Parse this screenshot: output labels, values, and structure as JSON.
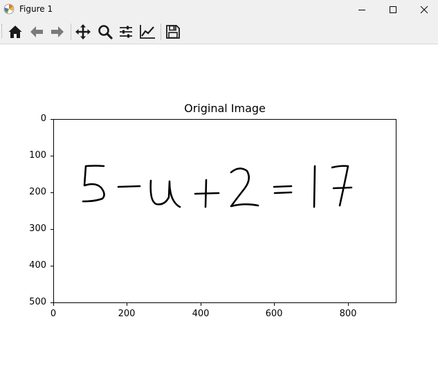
{
  "window": {
    "title": "Figure 1",
    "icon": "matplotlib-icon"
  },
  "window_controls": {
    "minimize_icon": "minimize-icon",
    "maximize_icon": "maximize-icon",
    "close_icon": "close-icon"
  },
  "toolbar": {
    "buttons": [
      {
        "name": "home",
        "icon": "home-icon"
      },
      {
        "name": "back",
        "icon": "arrow-left-icon"
      },
      {
        "name": "forward",
        "icon": "arrow-right-icon"
      },
      {
        "name": "pan",
        "icon": "move-icon"
      },
      {
        "name": "zoom",
        "icon": "zoom-icon"
      },
      {
        "name": "configure-subplots",
        "icon": "sliders-icon"
      },
      {
        "name": "edit-axes",
        "icon": "line-chart-icon"
      },
      {
        "name": "save",
        "icon": "save-icon"
      }
    ]
  },
  "chart_data": {
    "type": "image",
    "title": "Original Image",
    "image_content": "5-u+2=17",
    "xlim": [
      0,
      930
    ],
    "ylim": [
      500,
      0
    ],
    "x_ticks": [
      "0",
      "200",
      "400",
      "600",
      "800"
    ],
    "y_ticks": [
      "0",
      "100",
      "200",
      "300",
      "400",
      "500"
    ],
    "x_tick_values": [
      0,
      200,
      400,
      600,
      800
    ],
    "y_tick_values": [
      0,
      100,
      200,
      300,
      400,
      500
    ],
    "grid": false
  }
}
